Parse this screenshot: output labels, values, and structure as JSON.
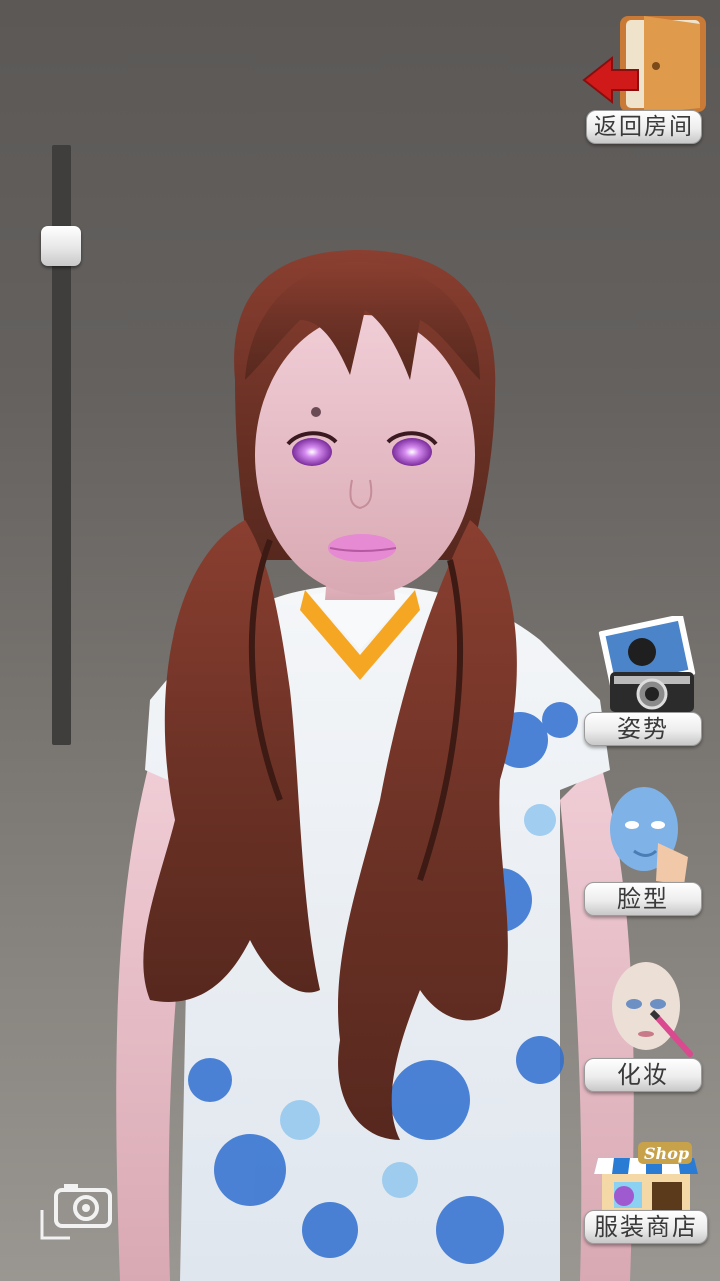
{
  "zoom_slider": {
    "level": 0.17
  },
  "buttons": {
    "back_label": "返回房间",
    "pose_label": "姿势",
    "face_label": "脸型",
    "makeup_label": "化妆",
    "shop_label": "服装商店",
    "shop_sign": "Shop"
  },
  "icons": {
    "back": "exit-door-icon",
    "pose": "photo-camera-icon",
    "face": "face-shape-icon",
    "makeup": "makeup-brush-icon",
    "shop": "storefront-icon",
    "snapshot": "camera-icon"
  },
  "colors": {
    "hair": "#7a3a2c",
    "dress_blue": "#2f6fd0",
    "lips": "#e28ad0",
    "eyes": "#b25cd6"
  }
}
